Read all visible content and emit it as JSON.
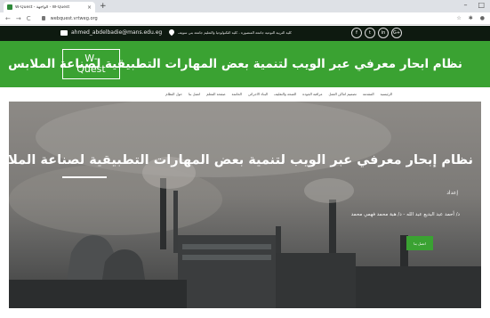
{
  "browser": {
    "tab_title": "W-Quest - الواجهة - W-Quest",
    "tab_close": "×",
    "new_tab": "+",
    "url": "webquest.vrtweg.org",
    "nav_back": "←",
    "nav_forward": "→",
    "nav_reload": "C",
    "win_min": "–",
    "win_max": "□",
    "star": "☆"
  },
  "topbar": {
    "email": "ahmed_abdelbadie@mans.edu.eg",
    "college": "كلية التربية النوعية جامعة المنصورة - كلية التكنولوجيا والتعليم جامعة بني سويف",
    "socials": [
      "f",
      "t",
      "in",
      "G+"
    ]
  },
  "header": {
    "logo_line1": "W-",
    "logo_line2": "Quest",
    "title": "نظام ابحار معرفي عبر الويب لتنمية بعض المهارات التطبيقية لصناعة الملابس"
  },
  "menu": {
    "items": [
      "الرئيسية",
      "المقدمة",
      "تصميم اماكن العمل",
      "مراقبة الجودة",
      "الصحة والتغليف",
      "البناء الاجرائي",
      "الخاتمة",
      "صفحة المعلم",
      "اتصل بنا",
      "حول النظام"
    ]
  },
  "hero": {
    "title": "نظام إبحار معرفي عبر الويب لتنمية بعض المهارات التطبيقية لصناعة الملابس",
    "prepared_by": "إعداد",
    "authors": "د/ أحمد عبد البديع عبد الله - د/ هبة محمد فهمي محمد",
    "contact_button": "اتصل بنا"
  },
  "colors": {
    "brand_green": "#3aa232",
    "topbar_dark": "#0e1a10"
  }
}
